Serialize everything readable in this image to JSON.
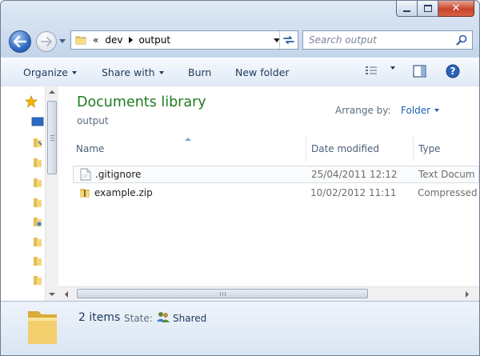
{
  "window": {
    "caption": {
      "close_glyph": "✕"
    }
  },
  "address": {
    "overflow": "«",
    "crumbs": [
      "dev",
      "output"
    ]
  },
  "search": {
    "placeholder": "Search output"
  },
  "toolbar": {
    "organize": "Organize",
    "share_with": "Share with",
    "burn": "Burn",
    "new_folder": "New folder"
  },
  "library": {
    "title": "Documents library",
    "subtitle": "output",
    "arrange_label": "Arrange by:",
    "arrange_value": "Folder"
  },
  "columns": {
    "name": "Name",
    "date": "Date modified",
    "type": "Type"
  },
  "files": [
    {
      "name": ".gitignore",
      "date": "25/04/2011 12:12",
      "type": "Text Docum",
      "icon": "text-document-icon"
    },
    {
      "name": "example.zip",
      "date": "10/02/2012 11:11",
      "type": "Compressed",
      "icon": "zip-folder-icon"
    }
  ],
  "details": {
    "count": "2 items",
    "state_label": "State:",
    "state_value": "Shared"
  }
}
